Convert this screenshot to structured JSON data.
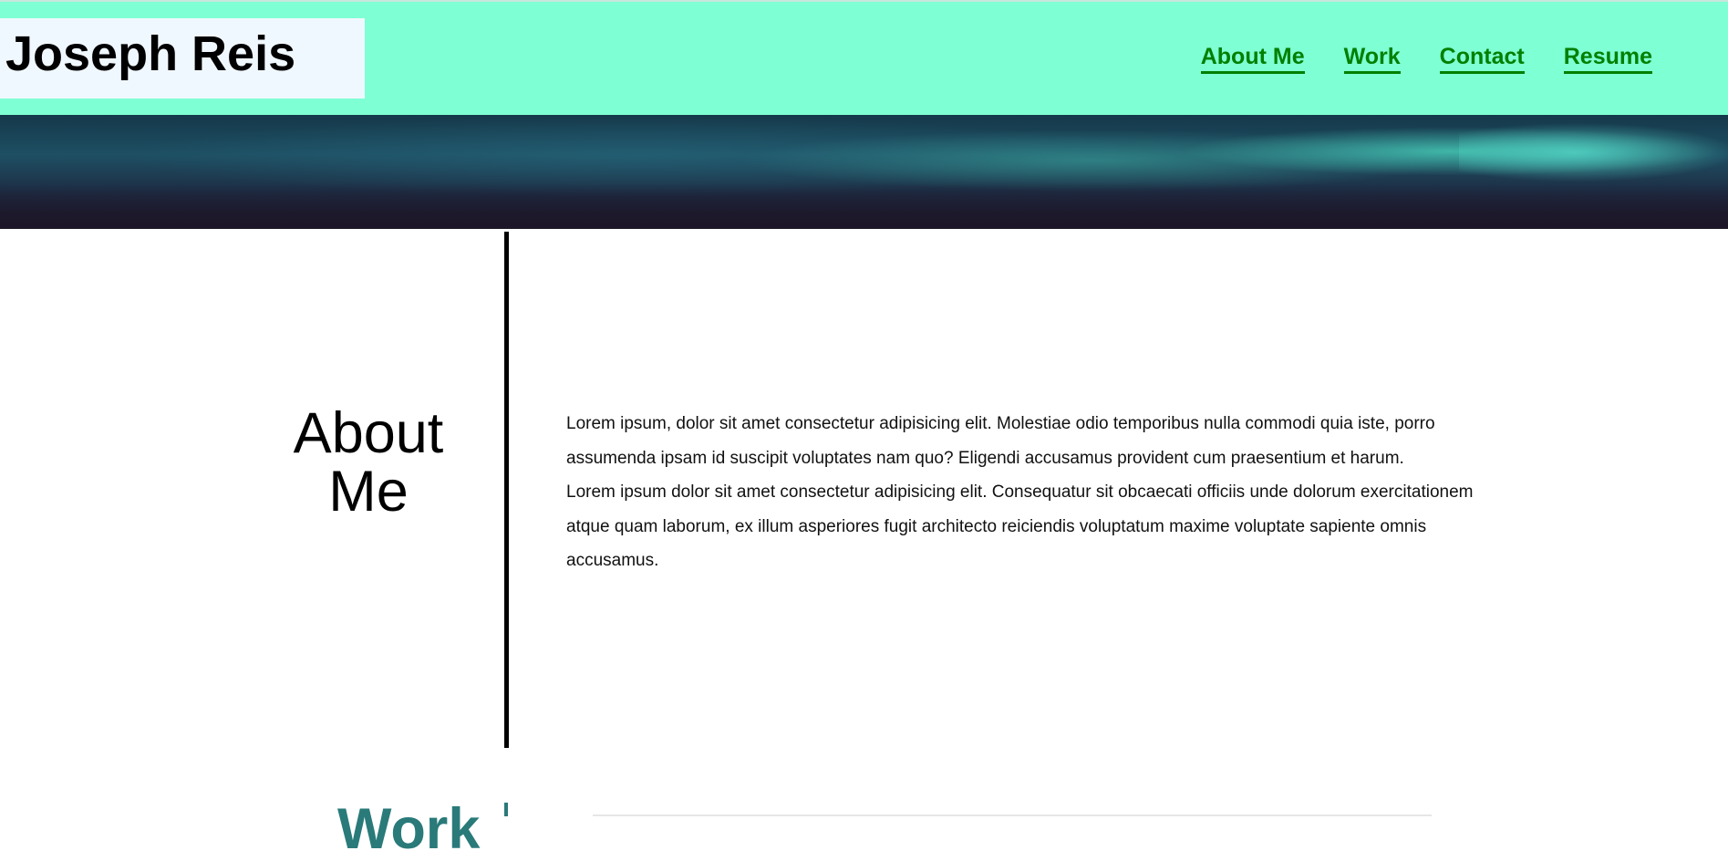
{
  "header": {
    "brand": "Joseph Reis",
    "nav": [
      {
        "label": "About Me"
      },
      {
        "label": "Work"
      },
      {
        "label": "Contact"
      },
      {
        "label": "Resume"
      }
    ]
  },
  "about": {
    "title_line1": "About",
    "title_line2": "Me",
    "paragraphs": [
      "Lorem ipsum, dolor sit amet consectetur adipisicing elit. Molestiae odio temporibus nulla commodi quia iste, porro assumenda ipsam id suscipit voluptates nam quo? Eligendi accusamus provident cum praesentium et harum.",
      "Lorem ipsum dolor sit amet consectetur adipisicing elit. Consequatur sit obcaecati officiis unde dolorum exercitationem atque quam laborum, ex illum asperiores fugit architecto reiciendis voluptatum maxime voluptate sapiente omnis accusamus."
    ]
  },
  "work": {
    "title": "Work"
  },
  "colors": {
    "header_bg": "#7fffd4",
    "brand_bg": "#f0f8ff",
    "nav_link": "#008000",
    "work_title": "#2a7a7a"
  }
}
